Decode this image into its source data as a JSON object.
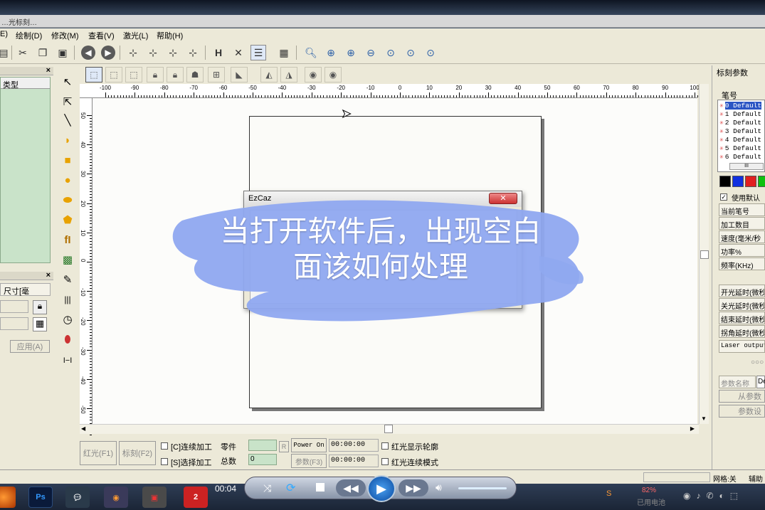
{
  "title_strip": "…光标刻…",
  "menus": [
    "E)",
    "绘制(D)",
    "修改(M)",
    "查看(V)",
    "激光(L)",
    "帮助(H)"
  ],
  "left_panel": {
    "list_header": "类型",
    "size_label": "尺寸[毫",
    "apply_button": "应用(A)"
  },
  "ruler_top_ticks": [
    "-100",
    "-90",
    "-80",
    "-70",
    "-60",
    "-50",
    "-40",
    "-30",
    "-20",
    "-10",
    "0",
    "10",
    "20",
    "30",
    "40",
    "50",
    "60",
    "70",
    "80",
    "90",
    "100"
  ],
  "ruler_left_ticks": [
    "50",
    "40",
    "30",
    "20",
    "10",
    "0",
    "-10",
    "-20",
    "-30",
    "-40",
    "-50"
  ],
  "dialog": {
    "title": "EzCaz",
    "close": "✕"
  },
  "caption": {
    "line1": "当打开软件后，出现空白",
    "line2": "面该如何处理"
  },
  "right_panel": {
    "title": "标刻参数",
    "pen_header": "笔号",
    "pens": [
      "0 Default",
      "1 Default",
      "2 Default",
      "3 Default",
      "4 Default",
      "5 Default",
      "6 Default"
    ],
    "scroll_mark": "III",
    "colors": [
      "#000000",
      "#1030e0",
      "#e02020",
      "#10c010"
    ],
    "use_default": "使用默认",
    "params": [
      "当前笔号",
      "加工数目",
      "速度(毫米/秒",
      "功率%",
      "频率(KHz)"
    ],
    "delays": [
      "开光延时(微秒",
      "关光延时(微秒",
      "结束延时(微秒",
      "拐角延时(微秒"
    ],
    "laser_output": "Laser output",
    "param_name": "参数名称",
    "param_value": "De",
    "from_param": "从参数",
    "param_set": "参数设"
  },
  "bottom": {
    "red_button": "红光(F1)",
    "mark_button": "标刻(F2)",
    "continuous": "[C]连续加工",
    "select": "[S]选择加工",
    "part_label": "零件",
    "total_label": "总数",
    "total_value": "0",
    "r_button": "R",
    "power_button": "Power On",
    "param_button": "参数(F3)",
    "time1": "00:00:00",
    "time2": "00:00:00",
    "red_outline": "红光显示轮廓",
    "red_continuous": "红光连续模式"
  },
  "status": {
    "grid": "网格:关",
    "assist": "辅助"
  },
  "player": {
    "time": "00:04"
  },
  "tray": {
    "battery": "82%",
    "battery_sub": "已用电池"
  }
}
